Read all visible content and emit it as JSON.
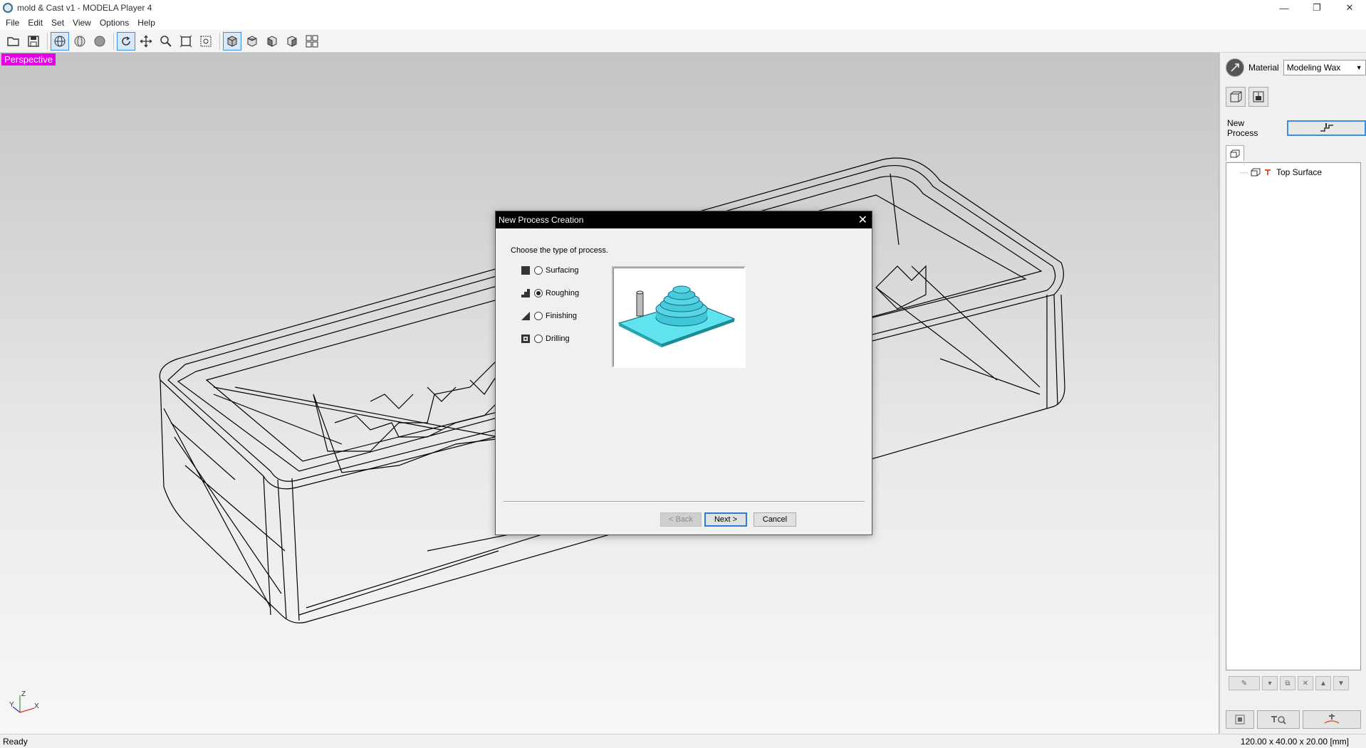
{
  "window": {
    "title": "mold & Cast v1 - MODELA Player 4",
    "minimize": "—",
    "maximize": "❐",
    "close": "✕"
  },
  "menu": [
    "File",
    "Edit",
    "Set",
    "View",
    "Options",
    "Help"
  ],
  "toolbar": {
    "buttons": [
      "open-icon",
      "save-icon",
      "wireframe-icon",
      "shaded-icon",
      "solid-icon",
      "rotate-icon",
      "move-icon",
      "zoom-icon",
      "fit-icon",
      "zoom-window-icon",
      "view-persp-icon",
      "view-top-icon",
      "view-front-icon",
      "view-side-icon",
      "multi-view-icon"
    ]
  },
  "viewport": {
    "label": "Perspective",
    "axis": {
      "x": "X",
      "y": "Y",
      "z": "Z"
    }
  },
  "panel": {
    "material_label": "Material",
    "material_value": "Modeling Wax",
    "new_process_label": "New Process",
    "tree_item": "Top Surface"
  },
  "status": {
    "left": "Ready",
    "right": "120.00 x 40.00 x 20.00 [mm]"
  },
  "dialog": {
    "title": "New Process Creation",
    "prompt": "Choose the type of process.",
    "options": [
      {
        "label": "Surfacing",
        "selected": false
      },
      {
        "label": "Roughing",
        "selected": true
      },
      {
        "label": "Finishing",
        "selected": false
      },
      {
        "label": "Drilling",
        "selected": false
      }
    ],
    "back": "< Back",
    "next": "Next >",
    "cancel": "Cancel"
  },
  "colors": {
    "accent": "#3a8ee6",
    "perspective_badge": "#e600e6",
    "preview_cyan": "#5fe3ef"
  }
}
